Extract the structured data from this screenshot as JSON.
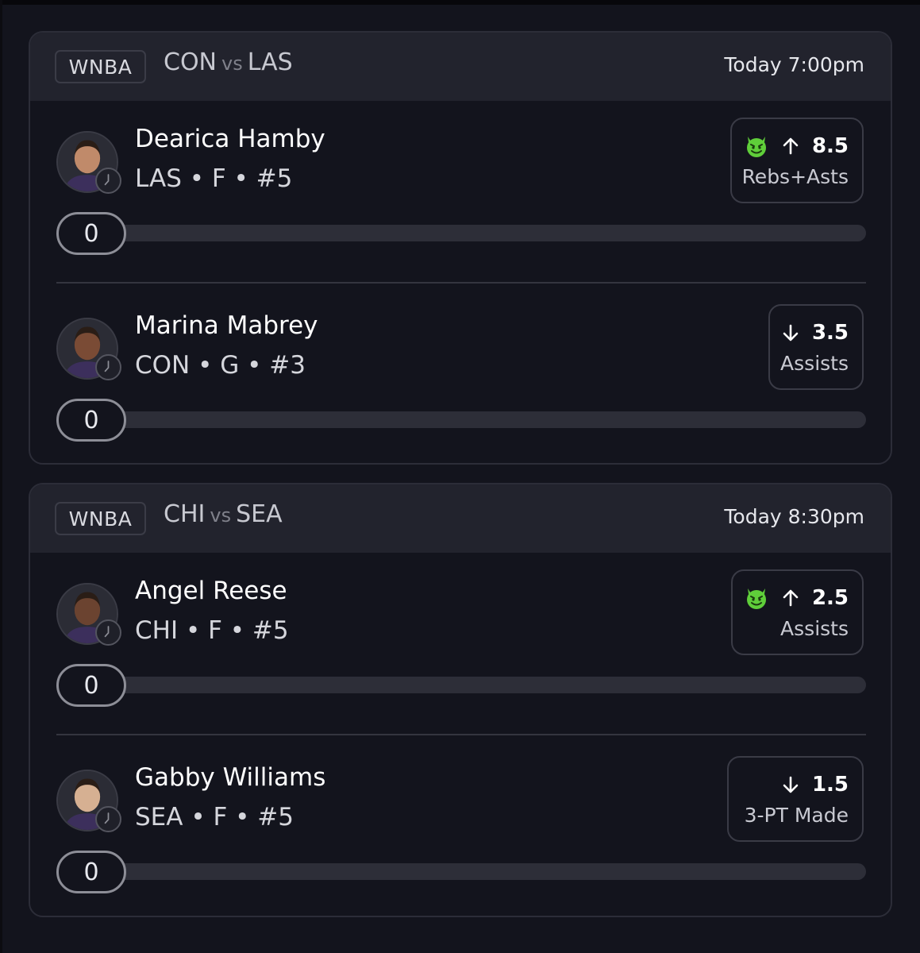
{
  "games": [
    {
      "league": "WNBA",
      "home": "CON",
      "vs": "vs",
      "away": "LAS",
      "time": "Today 7:00pm",
      "players": [
        {
          "name": "Dearica Hamby",
          "meta": "LAS • F • #5",
          "has_devil": true,
          "direction": "up",
          "line": "8.5",
          "stat": "Rebs+Asts",
          "current": "0",
          "progress_fraction": 0
        },
        {
          "name": "Marina Mabrey",
          "meta": "CON • G • #3",
          "has_devil": false,
          "direction": "down",
          "line": "3.5",
          "stat": "Assists",
          "current": "0",
          "progress_fraction": 0
        }
      ]
    },
    {
      "league": "WNBA",
      "home": "CHI",
      "vs": "vs",
      "away": "SEA",
      "time": "Today 8:30pm",
      "players": [
        {
          "name": "Angel Reese",
          "meta": "CHI • F • #5",
          "has_devil": true,
          "direction": "up",
          "line": "2.5",
          "stat": "Assists",
          "current": "0",
          "progress_fraction": 0
        },
        {
          "name": "Gabby Williams",
          "meta": "SEA • F • #5",
          "has_devil": false,
          "direction": "down",
          "line": "1.5",
          "stat": "3-PT Made",
          "current": "0",
          "progress_fraction": 0
        }
      ]
    }
  ],
  "icons": {
    "devil": "devil-face-icon",
    "up": "arrow-up-icon",
    "down": "arrow-down-icon",
    "clock": "clock-icon"
  },
  "colors": {
    "background": "#13141d",
    "header": "#22232d",
    "devil_green": "#5fce3a",
    "track": "#2d2e38"
  }
}
